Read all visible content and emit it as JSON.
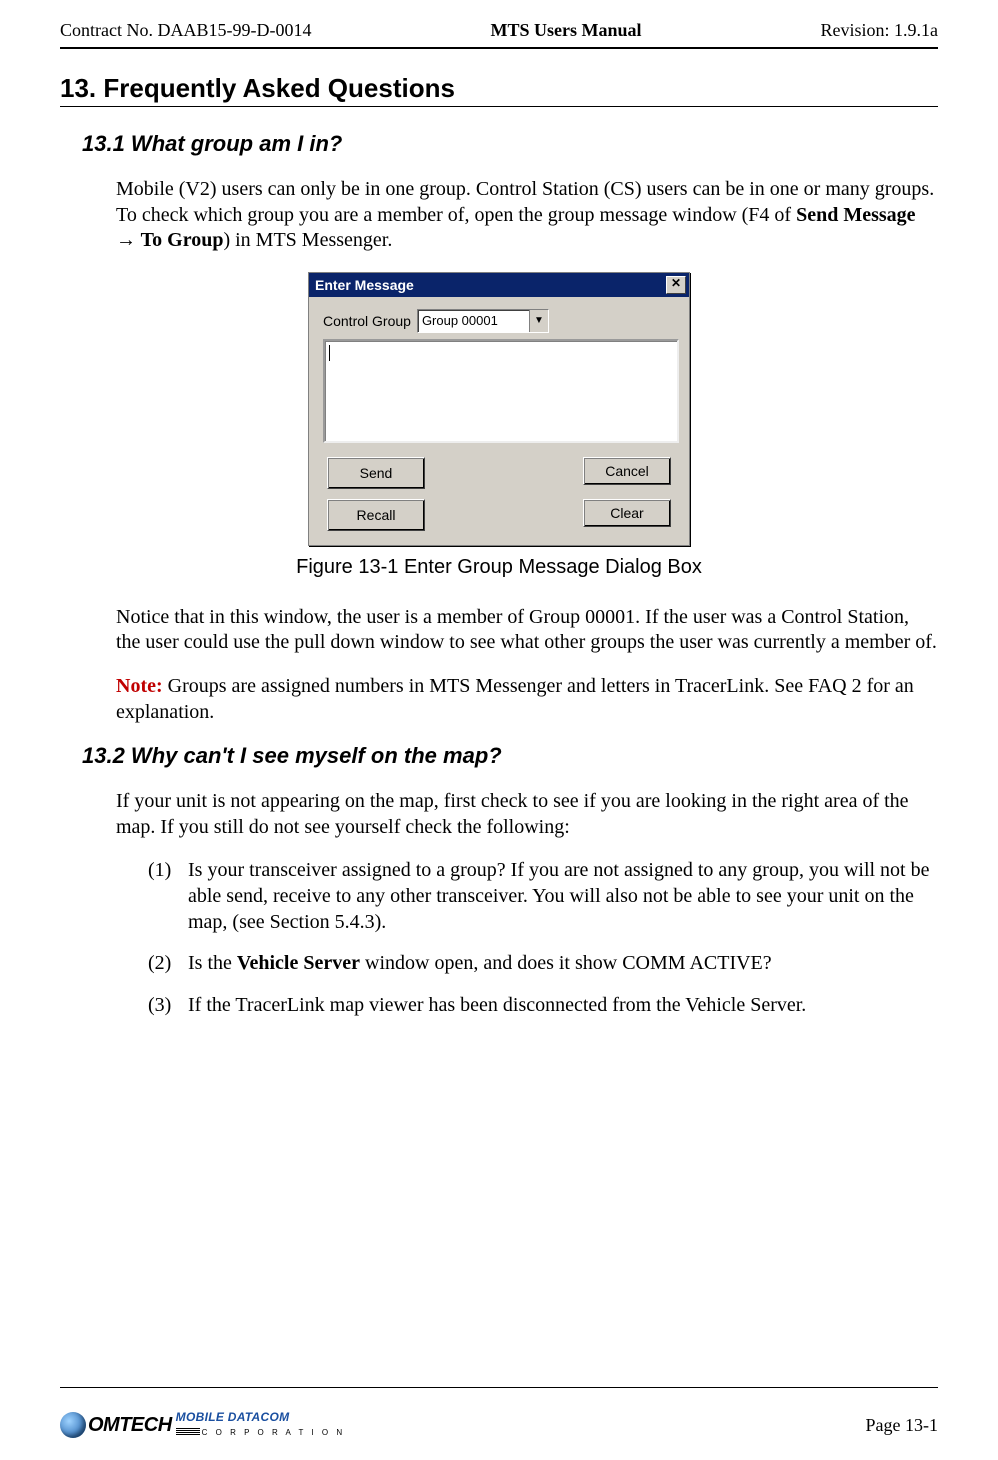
{
  "header": {
    "left": "Contract No. DAAB15-99-D-0014",
    "center": "MTS Users Manual",
    "right": "Revision:  1.9.1a"
  },
  "section": {
    "number_title": "13.  Frequently Asked Questions"
  },
  "sub1": {
    "title": "13.1  What group am I in?",
    "para1_pre": "Mobile (V2) users can only be in one group.  Control Station (CS) users can be in one or many groups.  To check which group you are a member of, open the group message window (F4 of ",
    "para1_bold": "Send Message → To Group",
    "para1_post": ") in MTS Messenger.",
    "dialog": {
      "title": "Enter Message",
      "close": "✕",
      "label": "Control Group",
      "combo_value": "Group 00001",
      "send": "Send",
      "cancel": "Cancel",
      "recall": "Recall",
      "clear": "Clear"
    },
    "figure_caption": "Figure 13-1   Enter Group Message Dialog Box",
    "para2": "Notice that in this window, the user is a member of Group 00001.  If the user was a Control Station, the user could use the pull down window to see what other groups the user was currently a member of.",
    "note_label": "Note:",
    "note_text": " Groups are assigned numbers in MTS Messenger and letters in TracerLink.  See FAQ 2 for an explanation."
  },
  "sub2": {
    "title": "13.2  Why can't I see myself on the map?",
    "intro": "If your unit is not appearing on the map, first check to see if you are looking in the right area of the map.  If you still do not see yourself check the following:",
    "items": [
      {
        "n": "(1)",
        "pre": "Is your transceiver assigned to a group?  If you are not assigned to any group, you will not be able send, receive to any other transceiver.  You will also not be able to see your unit on the map, (see Section 5.4.3).",
        "bold": "",
        "post": ""
      },
      {
        "n": "(2)",
        "pre": "Is the ",
        "bold": "Vehicle Server",
        "post": " window open, and does it show COMM ACTIVE?"
      },
      {
        "n": "(3)",
        "pre": "If the TracerLink map viewer has been disconnected from the Vehicle Server.",
        "bold": "",
        "post": ""
      }
    ]
  },
  "footer": {
    "logo_main": "OMTECH",
    "logo_sub": "MOBILE DATACOM",
    "logo_corp": "C O R P O R A T I O N",
    "page": "Page 13-1"
  }
}
